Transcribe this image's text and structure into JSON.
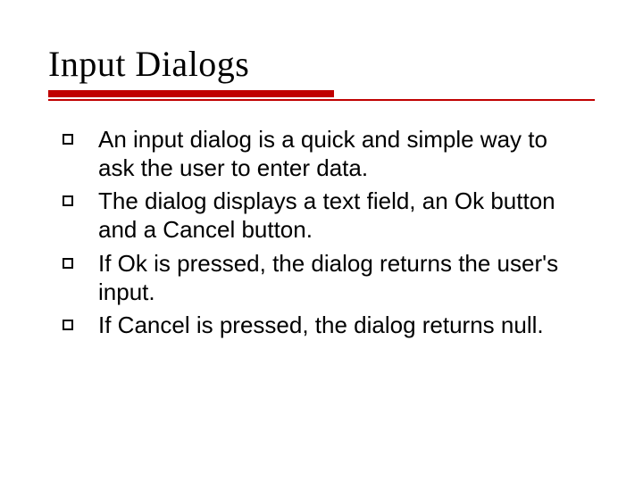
{
  "slide": {
    "title": "Input Dialogs",
    "bullets": [
      "An input dialog is a quick and simple way to ask the user to enter data.",
      "The dialog displays a text field, an Ok button and a Cancel button.",
      "If Ok is pressed, the dialog returns the user's input.",
      "If Cancel is pressed, the dialog returns null."
    ],
    "accent_color": "#c00000"
  }
}
